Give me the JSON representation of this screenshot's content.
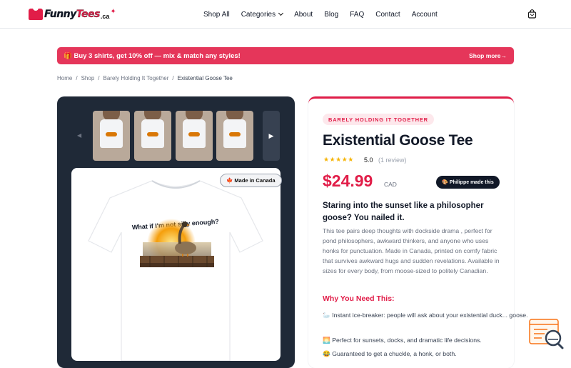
{
  "header": {
    "logo": {
      "text_main": "Funny",
      "text_accent": "Tees",
      "suffix": ".ca"
    },
    "nav": [
      "Shop All",
      "Categories",
      "About",
      "Blog",
      "FAQ",
      "Contact",
      "Account"
    ],
    "icons": [
      "tshirt-logo-icon",
      "maple-leaf-icon",
      "chevron-down-icon",
      "shopping-bag-icon"
    ]
  },
  "promo": {
    "text": "🎁 Buy 3 shirts, get 10% off — mix & match any styles!",
    "link": "Shop more→",
    "color": "#e5365a"
  },
  "breadcrumb": [
    "Home",
    "/",
    "Shop",
    "/",
    "Barely Holding It Together",
    "/",
    "Existential Goose Tee"
  ],
  "gallery": {
    "prev": "◀",
    "next": "▶",
    "thumbnail_count": 4,
    "badge": "🍁 Made in Canada",
    "print_text": "What if I'm not silly enough?"
  },
  "product": {
    "collection": "BARELY HOLDING IT TOGETHER",
    "title": "Existential Goose Tee",
    "stars": "★★★★★",
    "rating": "5.0",
    "reviews": "(1 review)",
    "price": "$24.99",
    "currency": "CAD",
    "maker": "🎨 Philippe made this",
    "tagline": "Staring into the sunset like a philosopher goose? You nailed it.",
    "description": "This tee pairs deep thoughts with dockside drama , perfect for pond philosophers, awkward thinkers, and anyone who uses honks for punctuation. Made in Canada, printed on comfy fabric that survives awkward hugs and sudden revelations. Available in sizes for every body, from moose-sized to politely Canadian.",
    "why_heading": "Why You Need This:",
    "bullets": [
      "🦢 Instant ice-breaker: people will ask about your existential duck... goose.",
      "🌅 Perfect for sunsets, docks, and dramatic life decisions.",
      "😂 Guaranteed to get a chuckle, a honk, or both."
    ],
    "accent": "#e11d48"
  }
}
